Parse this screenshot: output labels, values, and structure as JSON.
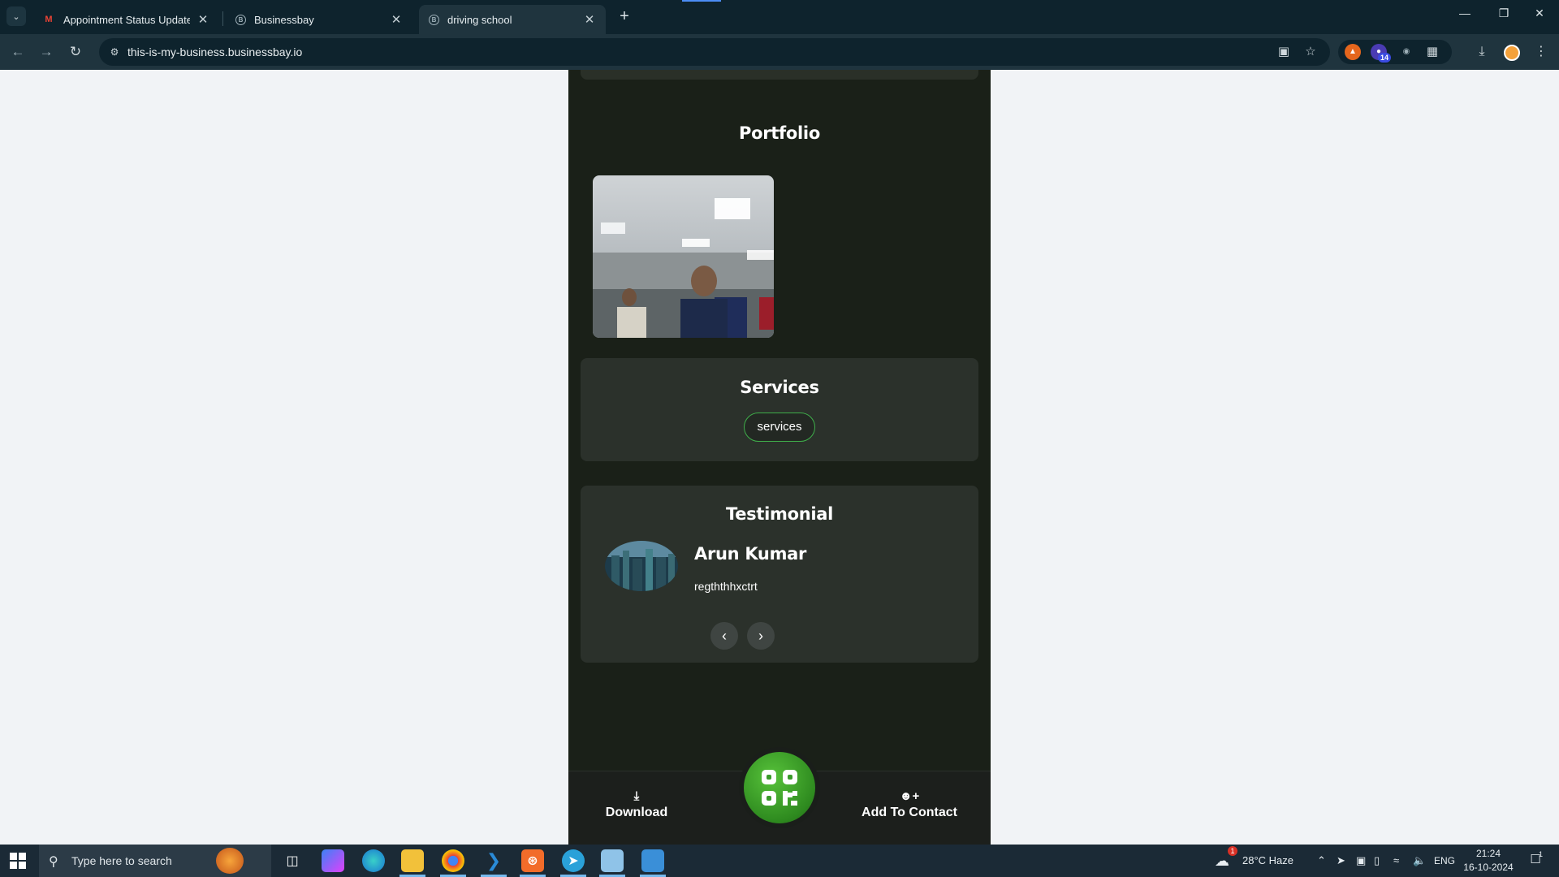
{
  "browser": {
    "tabs": [
      {
        "label": "Appointment Status Update: dr",
        "favicon": "gmail-icon",
        "active": false
      },
      {
        "label": "Businessbay",
        "favicon": "site-icon",
        "active": false
      },
      {
        "label": "driving school",
        "favicon": "site-icon",
        "active": true
      }
    ],
    "new_tab": "+",
    "url": "this-is-my-business.businessbay.io",
    "extension_badge": "14"
  },
  "page": {
    "portfolio": {
      "title": "Portfolio"
    },
    "services": {
      "title": "Services",
      "items": [
        "services"
      ]
    },
    "testimonial": {
      "title": "Testimonial",
      "name": "Arun Kumar",
      "text": "regththhxctrt"
    },
    "bottom_bar": {
      "download": "Download",
      "add_contact": "Add To Contact"
    },
    "colors": {
      "page_bg": "#1a2018",
      "panel": "#2b312b",
      "accent": "#3fae4a",
      "qr_green": "#3fa52b"
    }
  },
  "taskbar": {
    "search_placeholder": "Type here to search",
    "weather": "28°C  Haze",
    "weather_badge": "1",
    "language": "ENG",
    "time": "21:24",
    "date": "16-10-2024",
    "notification_count": "1"
  }
}
